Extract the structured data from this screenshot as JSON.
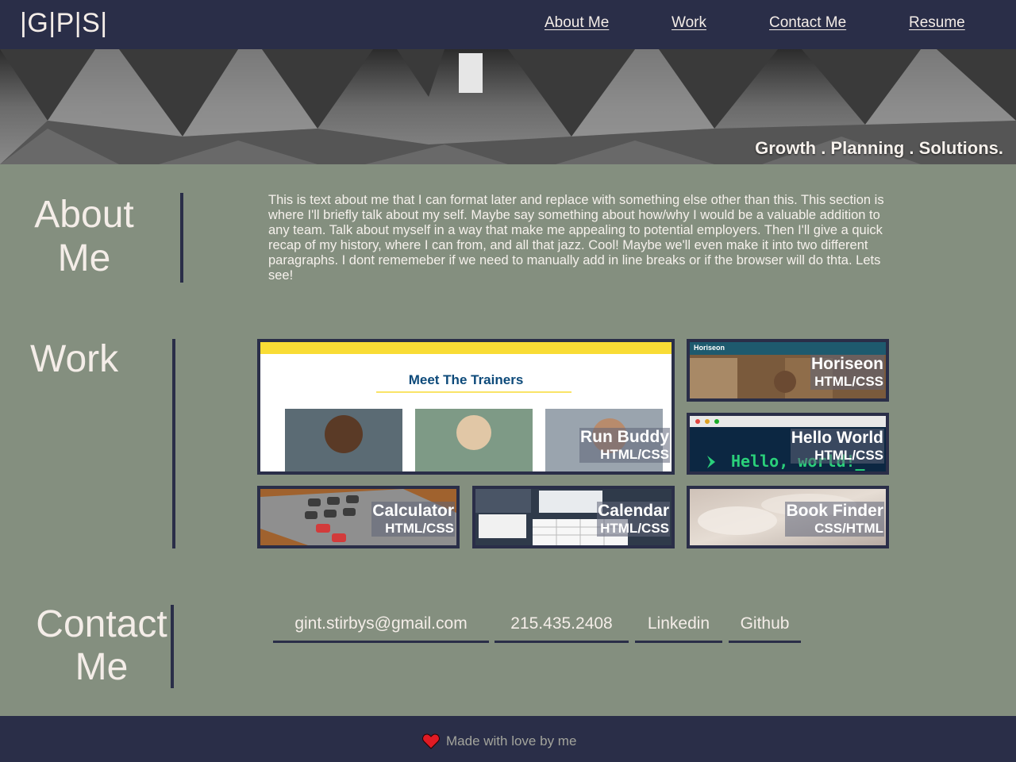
{
  "header": {
    "logo": "|G|P|S|",
    "nav": [
      {
        "label": "About Me"
      },
      {
        "label": "Work"
      },
      {
        "label": "Contact Me"
      },
      {
        "label": "Resume"
      }
    ]
  },
  "hero": {
    "tagline": "Growth . Planning . Solutions."
  },
  "about": {
    "title_line1": "About",
    "title_line2": "Me",
    "text": "This is text about me that I can format later and replace with something else other than this. This section is where I'll briefly talk about my self. Maybe say something about how/why I would be a valuable addition to any team. Talk about myself in a way that make me appealing to potential employers. Then I'll give a quick recap of my history, where I can from, and all that jazz. Cool! Maybe we'll even make it into two different paragraphs. I dont rememeber if we need to manually add in line breaks or if the browser will do thta. Lets see!"
  },
  "work": {
    "title": "Work",
    "projects": [
      {
        "name": "Run Buddy",
        "tech": "HTML/CSS",
        "thumb_heading": "Meet The Trainers"
      },
      {
        "name": "Horiseon",
        "tech": "HTML/CSS",
        "thumb_brand": "Horiseon"
      },
      {
        "name": "Hello World",
        "tech": "HTML/CSS",
        "thumb_text": "Hello, world!_"
      },
      {
        "name": "Calculator",
        "tech": "HTML/CSS"
      },
      {
        "name": "Calendar",
        "tech": "HTML/CSS"
      },
      {
        "name": "Book Finder",
        "tech": "CSS/HTML"
      }
    ]
  },
  "contact": {
    "title_line1": "Contact",
    "title_line2": "Me",
    "links": [
      {
        "label": "gint.stirbys@gmail.com"
      },
      {
        "label": "215.435.2408"
      },
      {
        "label": "Linkedin"
      },
      {
        "label": "Github"
      }
    ]
  },
  "footer": {
    "text": "Made with love by me",
    "icon": "heart-icon"
  },
  "colors": {
    "navy": "#2a2e48",
    "sage": "#848f7f",
    "text": "#f4ede8"
  }
}
